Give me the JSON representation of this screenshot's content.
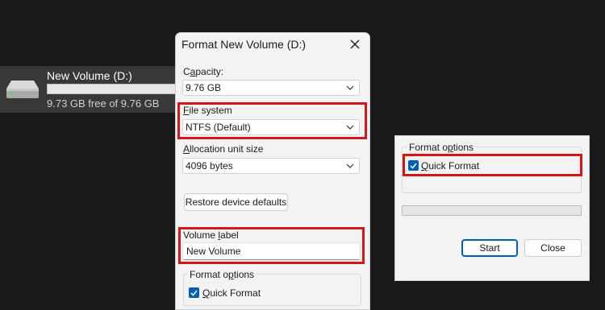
{
  "explorer": {
    "drive_name": "New Volume (D:)",
    "drive_free": "9.73 GB free of 9.76 GB",
    "drive_used_fraction": 0.003
  },
  "dialog": {
    "title": "Format New Volume (D:)",
    "capacity": {
      "label": "Capacity:",
      "value": "9.76 GB"
    },
    "file_system": {
      "label": "File system",
      "value": "NTFS (Default)"
    },
    "allocation": {
      "label": "Allocation unit size",
      "value": "4096 bytes"
    },
    "restore_label": "Restore device defaults",
    "volume_label": {
      "label": "Volume label",
      "value": "New Volume"
    },
    "format_options": {
      "legend": "Format options",
      "quick_format": "Quick Format",
      "quick_checked": true
    }
  },
  "panel2": {
    "format_options": {
      "legend": "Format options",
      "quick_format": "Quick Format",
      "quick_checked": true
    },
    "progress": 0,
    "start_label": "Start",
    "close_label": "Close"
  },
  "colors": {
    "highlight": "#d81414",
    "checkbox_accent": "#005fb8",
    "desktop_bg": "#191919"
  }
}
